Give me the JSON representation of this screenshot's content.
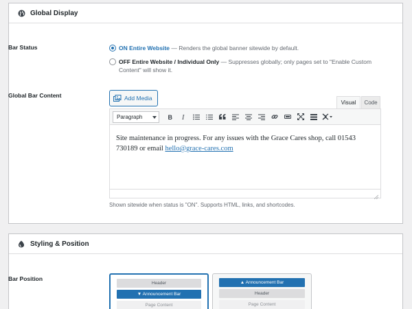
{
  "global_display": {
    "title": "Global Display",
    "bar_status": {
      "label": "Bar Status",
      "options": [
        {
          "label": "ON Entire Website",
          "desc": "— Renders the global banner sitewide by default.",
          "checked": true
        },
        {
          "label": "OFF Entire Website / Individual Only",
          "desc": "— Suppresses globally; only pages set to \"Enable Custom Content\" will show it.",
          "checked": false
        }
      ]
    },
    "bar_content": {
      "label": "Global Bar Content",
      "add_media": "Add Media",
      "tab_visual": "Visual",
      "tab_code": "Code",
      "format_select": "Paragraph",
      "content_text": "Site maintenance in progress. For any issues with the Grace Cares shop, call 01543 730189 or email ",
      "content_link": "hello@grace-cares.com",
      "help": "Shown sitewide when status is \"ON\". Supports HTML, links, and shortcodes."
    }
  },
  "styling": {
    "title": "Styling & Position",
    "bar_position": {
      "label": "Bar Position",
      "card_top": {
        "header": "Header",
        "bar": "▼ Announcement Bar",
        "content": "Page Content"
      },
      "card_bottom": {
        "bar": "▲ Announcement Bar",
        "header": "Header",
        "content": "Page Content"
      }
    }
  },
  "colors": {
    "accent": "#2271b1",
    "border": "#c3c4c7",
    "muted": "#646970"
  }
}
